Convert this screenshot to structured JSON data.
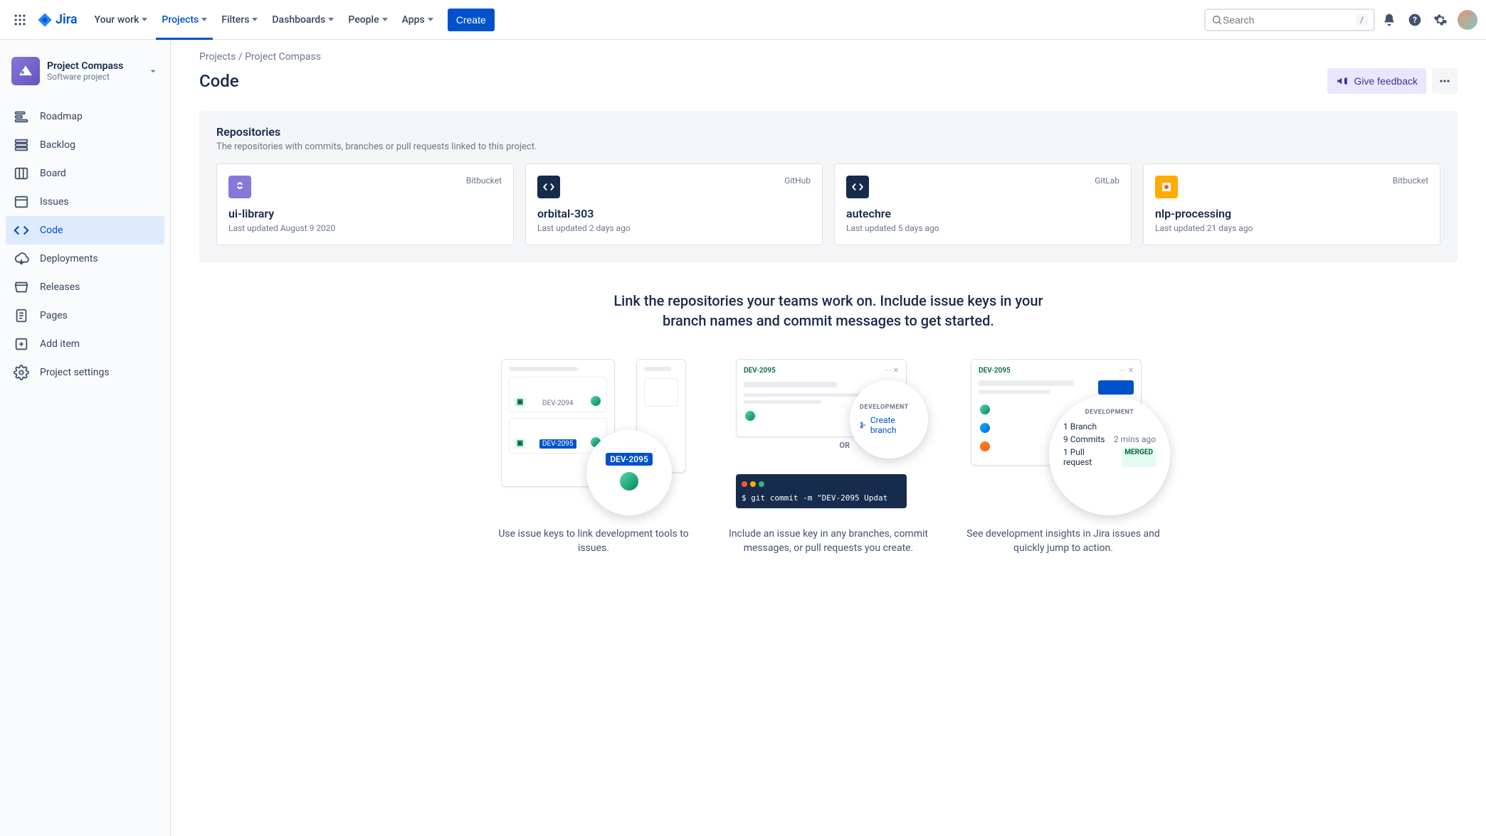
{
  "nav": {
    "items": [
      "Your work",
      "Projects",
      "Filters",
      "Dashboards",
      "People",
      "Apps"
    ],
    "active_index": 1,
    "create": "Create"
  },
  "search": {
    "placeholder": "Search",
    "kbd": "/"
  },
  "sidebar": {
    "project_name": "Project Compass",
    "project_type": "Software project",
    "items": [
      {
        "label": "Roadmap",
        "icon": "roadmap"
      },
      {
        "label": "Backlog",
        "icon": "backlog"
      },
      {
        "label": "Board",
        "icon": "board"
      },
      {
        "label": "Issues",
        "icon": "issues"
      },
      {
        "label": "Code",
        "icon": "code",
        "active": true
      },
      {
        "label": "Deployments",
        "icon": "deploy"
      },
      {
        "label": "Releases",
        "icon": "releases"
      },
      {
        "label": "Pages",
        "icon": "pages"
      },
      {
        "label": "Add item",
        "icon": "add"
      },
      {
        "label": "Project settings",
        "icon": "settings"
      }
    ]
  },
  "breadcrumb": {
    "root": "Projects",
    "sep": " / ",
    "project": "Project Compass"
  },
  "page": {
    "title": "Code",
    "feedback": "Give feedback"
  },
  "repos": {
    "heading": "Repositories",
    "sub": "The repositories with commits, branches or pull requests linked to this project.",
    "cards": [
      {
        "provider": "Bitbucket",
        "name": "ui-library",
        "updated": "Last updated August 9 2020",
        "icon_bg": "#8777D9"
      },
      {
        "provider": "GitHub",
        "name": "orbital-303",
        "updated": "Last updated 2 days ago",
        "icon_bg": "#172B4D"
      },
      {
        "provider": "GitLab",
        "name": "autechre",
        "updated": "Last updated 5 days ago",
        "icon_bg": "#172B4D"
      },
      {
        "provider": "Bitbucket",
        "name": "nlp-processing",
        "updated": "Last updated 21 days ago",
        "icon_bg": "#FFAB00"
      }
    ]
  },
  "onboard": {
    "title": "Link the repositories your teams work on. Include issue keys in your branch names and commit messages to get started.",
    "col1": {
      "issue_a": "DEV-2094",
      "issue_b": "DEV-2095",
      "text": "Use issue keys to link development tools to issues."
    },
    "col2": {
      "issue": "DEV-2095",
      "dev_label": "DEVELOPMENT",
      "create_branch": "Create branch",
      "or": "OR",
      "cmd": "$ git commit -m \"DEV-2095 Updat",
      "text": "Include an issue key in any branches, commit messages, or pull requests you create."
    },
    "col3": {
      "issue": "DEV-2095",
      "dev_label": "DEVELOPMENT",
      "branch": "1 Branch",
      "commits": "9 Commits",
      "commits_time": "2 mins ago",
      "pr": "1 Pull request",
      "merged": "MERGED",
      "text": "See development insights in Jira issues and quickly jump to action."
    }
  }
}
